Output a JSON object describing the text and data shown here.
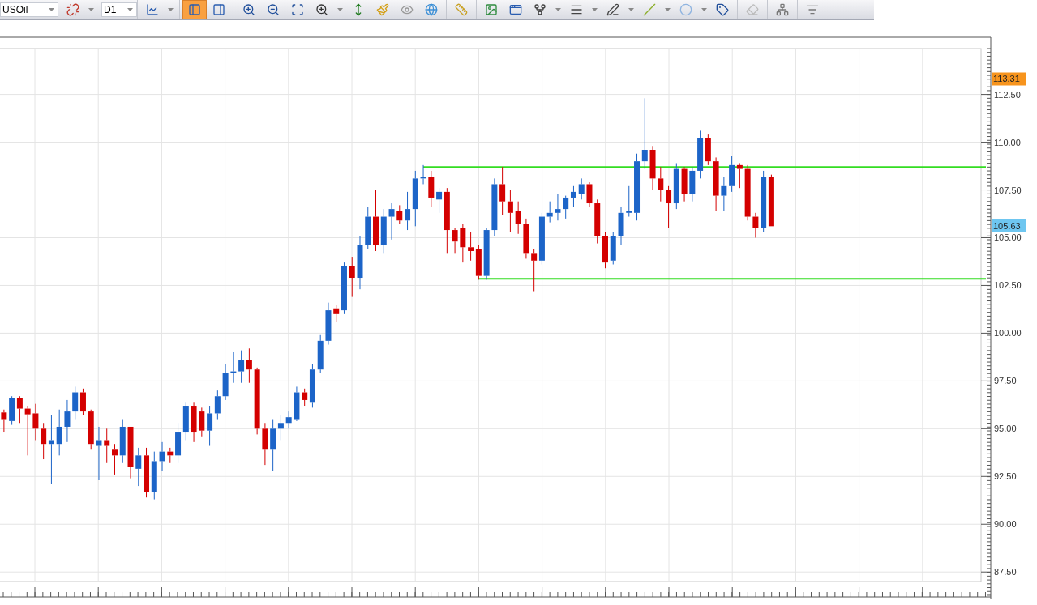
{
  "toolbar": {
    "symbol": "USOil",
    "timeframe": "D1",
    "groups": [
      [
        {
          "kind": "unlink",
          "dropdown": true,
          "selected": false
        }
      ],
      [
        {
          "kind": "chart",
          "dropdown": true,
          "selected": false
        }
      ],
      [
        {
          "kind": "panel-left",
          "dropdown": false,
          "selected": true
        },
        {
          "kind": "panel-right",
          "dropdown": false,
          "selected": false
        }
      ],
      [
        {
          "kind": "zoom-in",
          "dropdown": false,
          "selected": false
        },
        {
          "kind": "zoom-out",
          "dropdown": false,
          "selected": false
        },
        {
          "kind": "zoom-fit",
          "dropdown": false,
          "selected": false
        },
        {
          "kind": "zoom-range",
          "dropdown": true,
          "selected": false
        },
        {
          "kind": "height",
          "dropdown": false,
          "selected": false
        },
        {
          "kind": "brush",
          "dropdown": false,
          "selected": false
        },
        {
          "kind": "eye",
          "dropdown": false,
          "selected": false
        },
        {
          "kind": "globe",
          "dropdown": false,
          "selected": false
        }
      ],
      [
        {
          "kind": "ruler",
          "dropdown": false,
          "selected": false
        }
      ],
      [
        {
          "kind": "image",
          "dropdown": false,
          "selected": false
        },
        {
          "kind": "window",
          "dropdown": false,
          "selected": false
        },
        {
          "kind": "fork",
          "dropdown": true,
          "selected": false
        },
        {
          "kind": "lines",
          "dropdown": true,
          "selected": false
        },
        {
          "kind": "pen",
          "dropdown": true,
          "selected": false
        },
        {
          "kind": "trend",
          "dropdown": true,
          "selected": false
        },
        {
          "kind": "ellipse",
          "dropdown": true,
          "selected": false
        },
        {
          "kind": "label",
          "dropdown": false,
          "selected": false
        }
      ],
      [
        {
          "kind": "eraser",
          "dropdown": false,
          "selected": false
        }
      ],
      [
        {
          "kind": "tree",
          "dropdown": false,
          "selected": false
        }
      ],
      [
        {
          "kind": "overflow",
          "dropdown": false,
          "selected": false
        }
      ]
    ]
  },
  "price_markers": [
    {
      "label": "113.31",
      "color": "#f7941d"
    },
    {
      "label": "105.63",
      "color": "#6ec6f0"
    }
  ],
  "chart_data": {
    "type": "candlestick",
    "ylim": [
      87.0,
      114.9
    ],
    "grid": true,
    "categories": [
      null,
      null,
      null,
      null,
      null,
      null,
      null,
      null,
      null,
      null,
      null,
      null,
      null,
      null,
      null,
      null,
      null,
      null,
      null,
      null,
      null,
      null,
      null,
      null,
      null,
      null,
      null,
      null,
      null,
      null,
      null,
      null,
      null,
      null,
      null,
      null,
      null,
      null,
      null,
      null,
      null,
      null,
      null,
      null,
      null,
      null,
      null,
      null,
      null,
      null,
      null,
      null,
      null,
      null,
      null,
      null,
      null,
      null,
      null,
      null,
      null,
      null,
      null,
      null,
      null,
      null,
      null,
      null,
      null,
      null,
      null,
      null,
      null,
      null,
      null,
      null,
      null,
      null,
      null,
      null,
      null,
      null,
      null,
      null,
      null,
      null,
      null,
      null,
      null,
      null,
      null,
      null,
      null,
      null,
      null,
      null,
      null,
      null,
      null,
      null,
      null,
      null,
      null,
      null,
      null,
      null,
      null,
      null,
      null,
      null,
      null,
      null,
      null,
      null,
      null,
      null,
      null,
      null,
      null,
      null,
      null,
      null,
      null,
      null
    ],
    "yticks": [
      {
        "value": 87.5,
        "label": "87.50"
      },
      {
        "value": 90,
        "label": "90.00"
      },
      {
        "value": 92.5,
        "label": "92.50"
      },
      {
        "value": 95,
        "label": "95.00"
      },
      {
        "value": 97.5,
        "label": "97.50"
      },
      {
        "value": 100,
        "label": "100.00"
      },
      {
        "value": 102.5,
        "label": "102.50"
      },
      {
        "value": 105,
        "label": "105.00"
      },
      {
        "value": 107.5,
        "label": "107.50"
      },
      {
        "value": 110,
        "label": "110.00"
      },
      {
        "value": 112.5,
        "label": "112.50"
      }
    ],
    "ohlc": [
      [
        95.85,
        96,
        94.8,
        95.5
      ],
      [
        95.4,
        96.7,
        95.2,
        96.6
      ],
      [
        96.6,
        96.7,
        95.3,
        96.05
      ],
      [
        96.05,
        96.2,
        93.6,
        95.75
      ],
      [
        95.8,
        96.3,
        94.4,
        95
      ],
      [
        95,
        95.3,
        93.4,
        94.2
      ],
      [
        94.2,
        95.7,
        92.1,
        94.4
      ],
      [
        94.2,
        96,
        93.6,
        95.1
      ],
      [
        95.1,
        96.5,
        94.3,
        95.9
      ],
      [
        95.9,
        97.2,
        95.5,
        96.9
      ],
      [
        96.9,
        97.1,
        95.7,
        95.9
      ],
      [
        95.9,
        96,
        93.9,
        94.2
      ],
      [
        94.1,
        95.1,
        92.3,
        94.4
      ],
      [
        94.4,
        95,
        93.2,
        94.1
      ],
      [
        93.9,
        94.2,
        92.6,
        93.6
      ],
      [
        93.6,
        95.5,
        93.2,
        95.1
      ],
      [
        95.1,
        95.1,
        92.4,
        93
      ],
      [
        92.9,
        94,
        92,
        93.6
      ],
      [
        93.6,
        94,
        91.4,
        91.7
      ],
      [
        91.7,
        93.8,
        91.3,
        93.3
      ],
      [
        93.3,
        94.3,
        92.8,
        93.8
      ],
      [
        93.8,
        94,
        93.2,
        93.6
      ],
      [
        93.6,
        95.3,
        93.2,
        94.8
      ],
      [
        94.8,
        96.4,
        94.4,
        96.2
      ],
      [
        96.2,
        96.4,
        94.3,
        94.8
      ],
      [
        95.9,
        96.1,
        94.6,
        94.9
      ],
      [
        94.9,
        96.2,
        94.1,
        95.8
      ],
      [
        95.8,
        97,
        95.5,
        96.7
      ],
      [
        96.7,
        98.4,
        96.5,
        97.9
      ],
      [
        97.9,
        99,
        97.4,
        98
      ],
      [
        98,
        99.1,
        97.4,
        98.6
      ],
      [
        98.6,
        99.2,
        97.4,
        98.1
      ],
      [
        98.1,
        98.2,
        94.7,
        95
      ],
      [
        95,
        95.3,
        93.1,
        93.9
      ],
      [
        93.9,
        95.5,
        92.8,
        95
      ],
      [
        95,
        95.7,
        94.4,
        95.3
      ],
      [
        95.3,
        95.9,
        95,
        95.6
      ],
      [
        95.5,
        97.2,
        95.4,
        96.9
      ],
      [
        96.9,
        97.1,
        96.2,
        96.5
      ],
      [
        96.4,
        98.4,
        96.1,
        98.1
      ],
      [
        98.1,
        99.9,
        97.9,
        99.6
      ],
      [
        99.6,
        101.6,
        99.4,
        101.2
      ],
      [
        101.3,
        101.5,
        100.6,
        101
      ],
      [
        101.2,
        103.7,
        101,
        103.5
      ],
      [
        103.5,
        104,
        101.9,
        102.9
      ],
      [
        102.9,
        105.1,
        102.3,
        104.6
      ],
      [
        104.6,
        106.6,
        104.4,
        106.1
      ],
      [
        106.1,
        107.5,
        104.3,
        104.6
      ],
      [
        104.6,
        106.5,
        104.2,
        106.1
      ],
      [
        106.1,
        106.8,
        104.9,
        106.5
      ],
      [
        106.4,
        106.7,
        105.7,
        105.9
      ],
      [
        105.9,
        107.4,
        105.4,
        106.5
      ],
      [
        106.5,
        108.5,
        105.6,
        108.1
      ],
      [
        108.1,
        108.8,
        107.8,
        108.2
      ],
      [
        108.2,
        108.5,
        106.6,
        107.1
      ],
      [
        107,
        107.6,
        106.3,
        107.4
      ],
      [
        107.4,
        107.6,
        104.2,
        105.4
      ],
      [
        105.4,
        105.5,
        104.2,
        104.8
      ],
      [
        105.5,
        105.7,
        103.7,
        104.5
      ],
      [
        104.5,
        105.3,
        103.8,
        104.3
      ],
      [
        104.4,
        104.6,
        102.8,
        103
      ],
      [
        103,
        105.5,
        102.8,
        105.4
      ],
      [
        105.4,
        108.1,
        105.1,
        107.8
      ],
      [
        107.8,
        108.7,
        106.2,
        106.9
      ],
      [
        106.9,
        107.5,
        105.3,
        106.3
      ],
      [
        106.4,
        106.9,
        105.2,
        105.7
      ],
      [
        105.7,
        106,
        103.9,
        104.2
      ],
      [
        104.2,
        104.4,
        102.2,
        103.8
      ],
      [
        103.8,
        106.3,
        103.6,
        106.1
      ],
      [
        106.1,
        106.9,
        105.8,
        106.3
      ],
      [
        106.3,
        107.3,
        105.9,
        106.5
      ],
      [
        106.5,
        107.2,
        106,
        107.1
      ],
      [
        107.1,
        107.7,
        106.6,
        107.4
      ],
      [
        107.3,
        108.1,
        107,
        107.8
      ],
      [
        107.8,
        107.9,
        106.6,
        106.8
      ],
      [
        106.8,
        107,
        104.7,
        105.1
      ],
      [
        105.1,
        105.3,
        103.4,
        103.7
      ],
      [
        103.8,
        105.3,
        103.6,
        105.1
      ],
      [
        105.1,
        106.6,
        104.6,
        106.3
      ],
      [
        106.3,
        107.7,
        106.1,
        106.4
      ],
      [
        106.3,
        109.4,
        105.9,
        109
      ],
      [
        109,
        112.3,
        108.6,
        109.6
      ],
      [
        109.6,
        109.8,
        107.5,
        108.1
      ],
      [
        108.1,
        108.7,
        106.9,
        107.5
      ],
      [
        107.5,
        107.7,
        105.5,
        106.8
      ],
      [
        106.8,
        108.9,
        106.5,
        108.6
      ],
      [
        108.6,
        108.7,
        106.9,
        107.3
      ],
      [
        107.3,
        108.7,
        106.9,
        108.5
      ],
      [
        108.5,
        110.6,
        108.1,
        110.2
      ],
      [
        110.2,
        110.4,
        108.8,
        109
      ],
      [
        109,
        109.2,
        106.4,
        107.2
      ],
      [
        107.2,
        108.2,
        106.4,
        107.7
      ],
      [
        107.7,
        109.3,
        107.4,
        108.8
      ],
      [
        108.8,
        108.9,
        107.6,
        108.6
      ],
      [
        108.6,
        108.8,
        105.9,
        106.1
      ],
      [
        106.1,
        106.3,
        105,
        105.5
      ],
      [
        105.5,
        108.5,
        105.3,
        108.2
      ],
      [
        108.2,
        108.3,
        105.6,
        105.6
      ],
      null,
      null,
      null,
      null,
      null,
      null,
      null,
      null,
      null,
      null,
      null,
      null,
      null,
      null,
      null,
      null,
      null,
      null,
      null,
      null,
      null,
      null,
      null,
      null,
      null,
      null
    ],
    "ref_lines": [
      {
        "axis": "y",
        "value": 108.7,
        "color": "#33dd22"
      },
      {
        "axis": "y",
        "value": 102.85,
        "color": "#33dd22"
      },
      {
        "axis": "y",
        "value": 113.31,
        "color": "#c8c8c8"
      }
    ]
  }
}
